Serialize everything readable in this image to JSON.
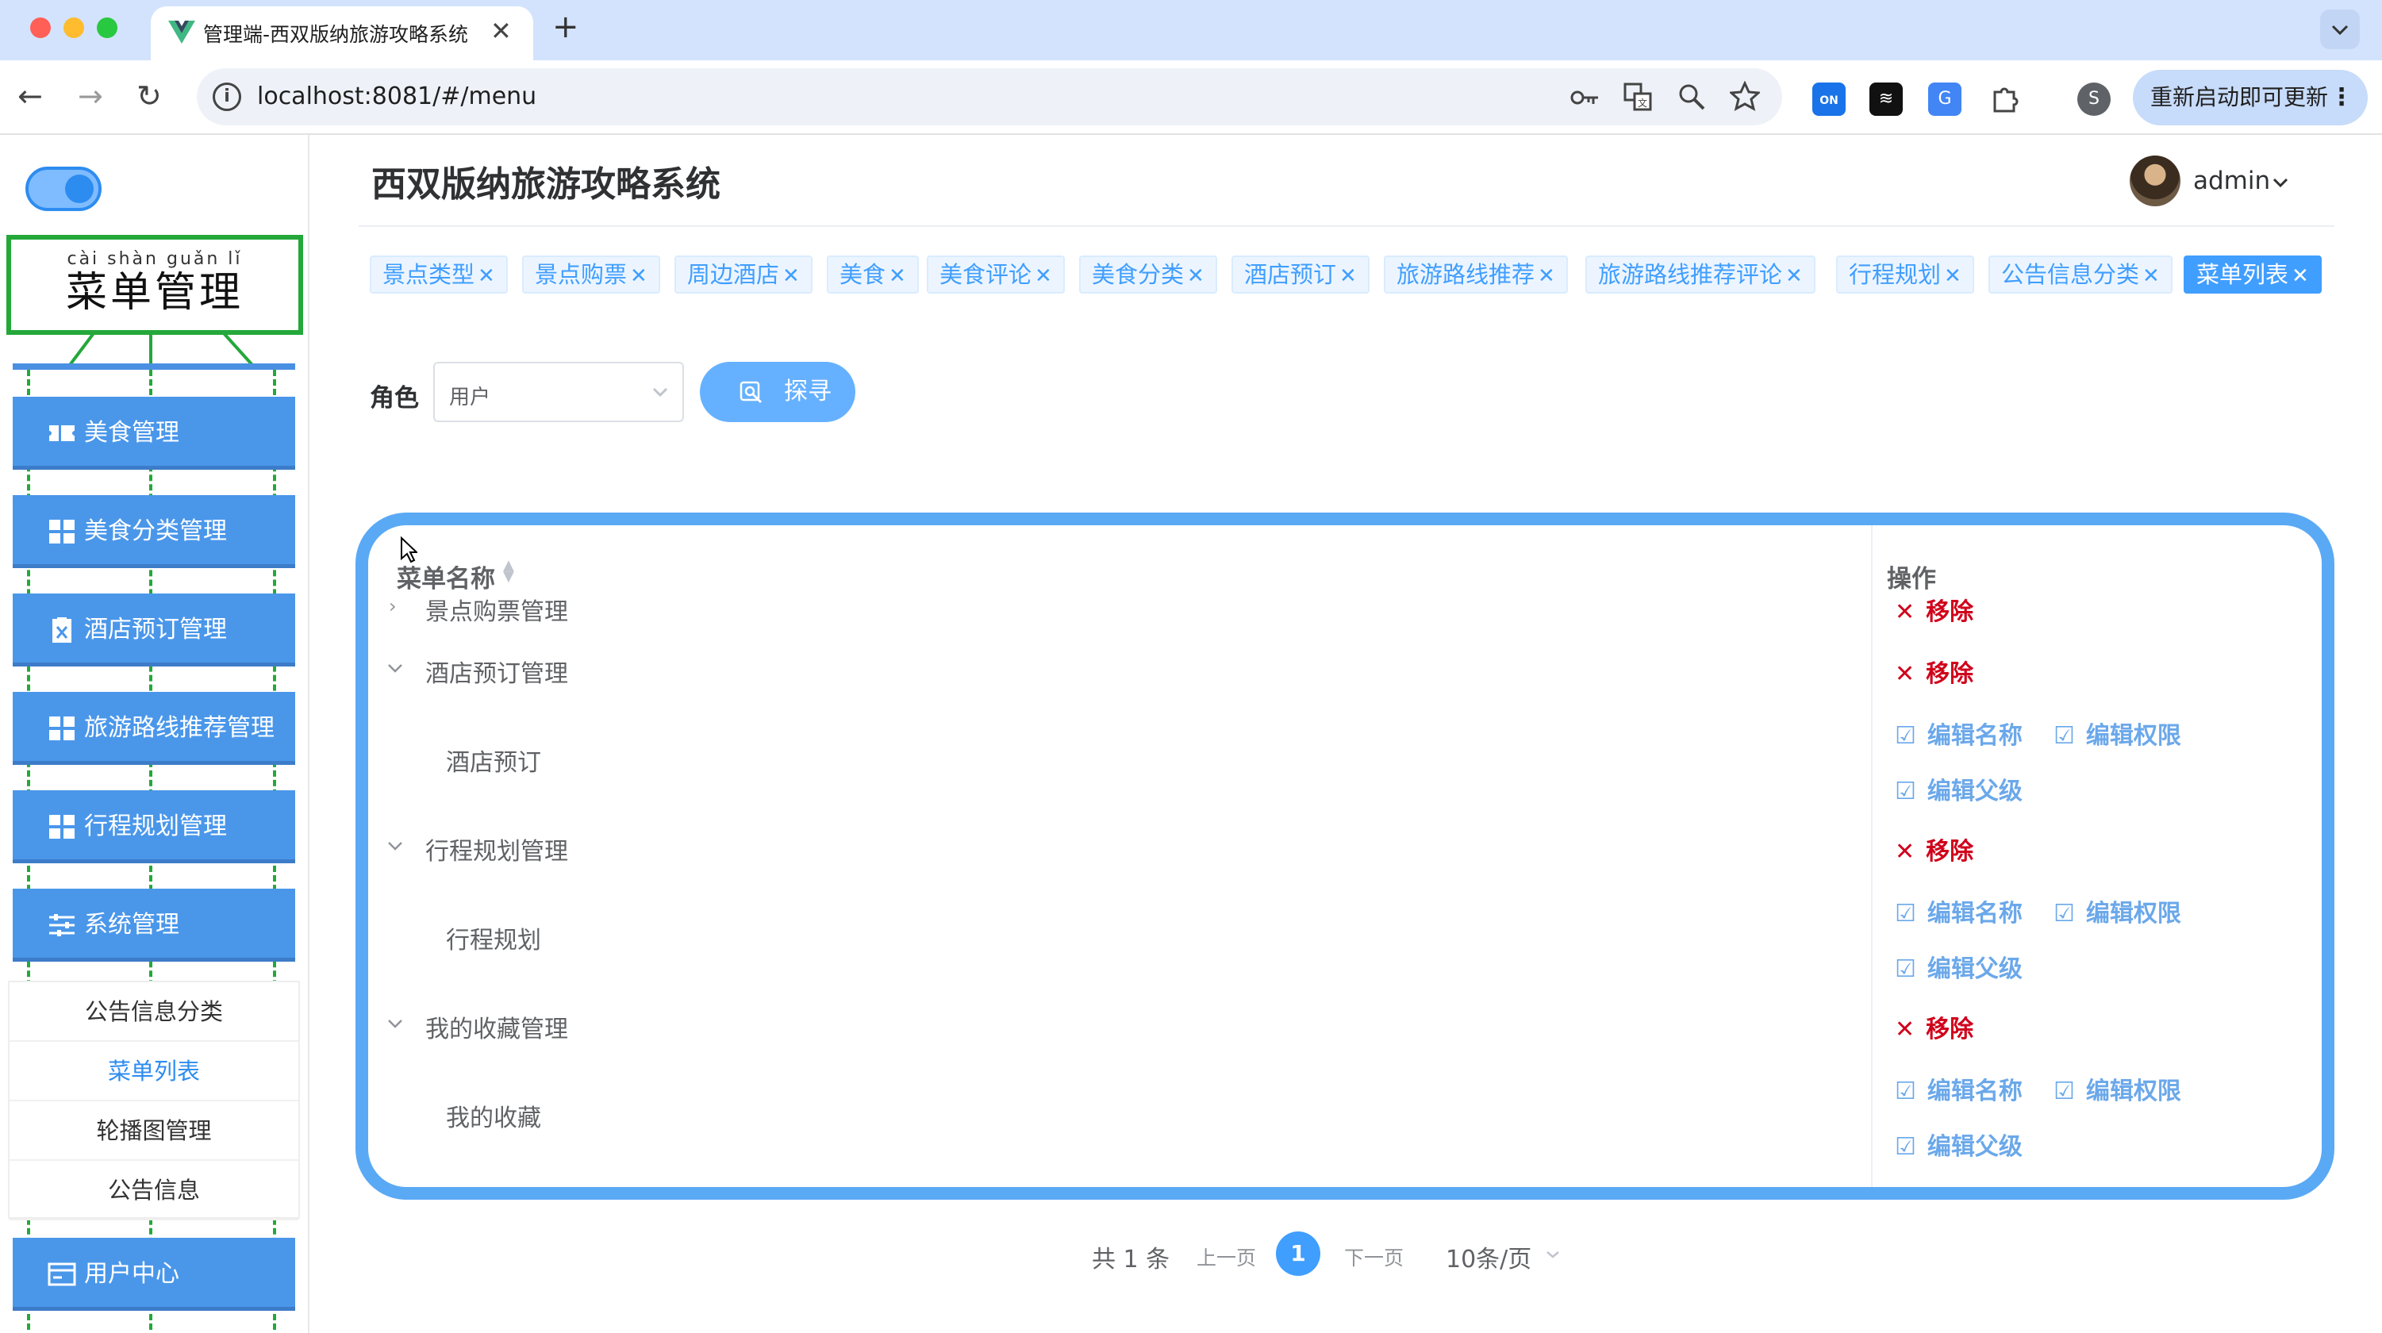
{
  "browser": {
    "tab_title": "管理端-西双版纳旅游攻略系统",
    "tab_close": "✕",
    "new_tab": "+",
    "url": "localhost:8081/#/menu",
    "update_label": "重新启动即可更新",
    "profile_initial": "S",
    "ext_on_label": "ON"
  },
  "sidebar": {
    "logo_pinyin": "cài shàn guǎn lǐ",
    "logo_text": "菜单管理",
    "menu_items": [
      {
        "label": "美食管理",
        "icon": "ticket-icon"
      },
      {
        "label": "美食分类管理",
        "icon": "grid-icon"
      },
      {
        "label": "酒店预订管理",
        "icon": "clipboard-icon"
      },
      {
        "label": "旅游路线推荐管理",
        "icon": "grid-icon"
      },
      {
        "label": "行程规划管理",
        "icon": "grid-icon"
      },
      {
        "label": "系统管理",
        "icon": "sliders-icon"
      }
    ],
    "sub_items": [
      "公告信息分类",
      "菜单列表",
      "轮播图管理",
      "公告信息"
    ],
    "active_sub": "菜单列表",
    "user_center": "用户中心"
  },
  "header": {
    "title": "西双版纳旅游攻略系统",
    "username": "admin"
  },
  "tags": [
    "景点类型",
    "景点购票",
    "周边酒店",
    "美食",
    "美食评论",
    "美食分类",
    "酒店预订",
    "旅游路线推荐",
    "旅游路线推荐评论",
    "行程规划",
    "公告信息分类",
    "菜单列表"
  ],
  "active_tag": "菜单列表",
  "search": {
    "label": "角色",
    "value": "用户",
    "button": "探寻"
  },
  "table": {
    "col_name": "菜单名称",
    "col_op": "操作",
    "rows": [
      {
        "name": "景点购票管理",
        "level": 0,
        "expanded": false
      },
      {
        "name": "酒店预订管理",
        "level": 0,
        "expanded": true
      },
      {
        "name": "酒店预订",
        "level": 1
      },
      {
        "name": "行程规划管理",
        "level": 0,
        "expanded": true
      },
      {
        "name": "行程规划",
        "level": 1
      },
      {
        "name": "我的收藏管理",
        "level": 0,
        "expanded": true
      },
      {
        "name": "我的收藏",
        "level": 1
      }
    ],
    "ops": {
      "remove": "移除",
      "edit_name": "编辑名称",
      "edit_perm": "编辑权限",
      "edit_parent": "编辑父级"
    }
  },
  "pagination": {
    "total": "共 1 条",
    "prev": "上一页",
    "page": "1",
    "next": "下一页",
    "page_size": "10条/页"
  },
  "colors": {
    "primary": "#409eff",
    "sidebar_item": "#4a97ea",
    "remove": "#d0021b",
    "edit": "#6ba8ea",
    "logo_border": "#24a83a"
  }
}
